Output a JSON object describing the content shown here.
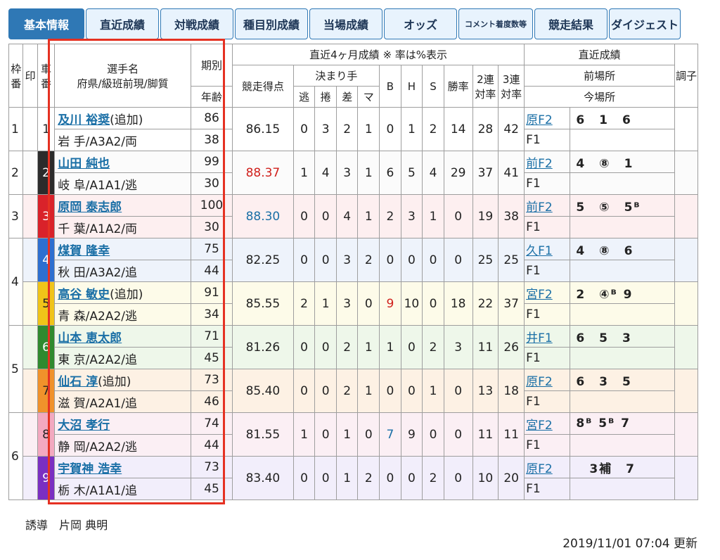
{
  "tabs": [
    {
      "label": "基本情報",
      "active": true
    },
    {
      "label": "直近成績"
    },
    {
      "label": "対戦成績"
    },
    {
      "label": "種目別成績"
    },
    {
      "label": "当場成績"
    },
    {
      "label": "オッズ"
    },
    {
      "label": "コメント着度数等",
      "small": true
    },
    {
      "label": "競走結果"
    },
    {
      "label": "ダイジェスト"
    }
  ],
  "headers": {
    "waku": "枠番",
    "mark": "印",
    "car": "車番",
    "name": "選手名",
    "pref": "府県/級班前現/脚質",
    "term": "期別",
    "age": "年齢",
    "recent4": "直近4ヶ月成績 ※ 率は%表示",
    "score": "競走得点",
    "kimarite": "決まり手",
    "nige": "逃",
    "makuri": "捲",
    "sashi": "差",
    "mark_k": "マ",
    "b": "B",
    "h": "H",
    "s": "S",
    "win": "勝率",
    "ren2": "2連対率",
    "ren3": "3連対率",
    "recent": "直近成績",
    "prev_place": "前場所",
    "cur_place": "今場所",
    "chou": "調子"
  },
  "waku_labels": [
    "1",
    "2",
    "3",
    "4",
    "5",
    "6"
  ],
  "riders": [
    {
      "car": "1",
      "carcolor": "#ffffff",
      "cartext": "#222",
      "name": "及川 裕奨",
      "suffix": "(追加)",
      "pref": "岩 手/A3A2/両",
      "term": "86",
      "age": "38",
      "score": "86.15",
      "score_color": "#222",
      "nige": "0",
      "makuri": "3",
      "sashi": "2",
      "mark": "1",
      "b": "0",
      "h": "1",
      "s": "2",
      "win": "14",
      "ren2": "28",
      "ren3": "42",
      "prev_place": "原F2",
      "prev_res": "6　1　6",
      "cur_place": "F1"
    },
    {
      "car": "2",
      "carcolor": "#2b2b2b",
      "cartext": "#fff",
      "name": "山田 純也",
      "suffix": "",
      "pref": "岐 阜/A1A1/逃",
      "term": "99",
      "age": "30",
      "score": "88.37",
      "score_color": "#d0201c",
      "nige": "1",
      "makuri": "4",
      "sashi": "3",
      "mark": "1",
      "b": "6",
      "h": "5",
      "s": "4",
      "win": "29",
      "ren2": "37",
      "ren3": "41",
      "prev_place": "前F2",
      "prev_res": "4　⑧　1",
      "cur_place": "F1"
    },
    {
      "car": "3",
      "carcolor": "#d9222a",
      "cartext": "#fff",
      "name": "原岡 泰志郎",
      "suffix": "",
      "pref": "千 葉/A1A2/両",
      "term": "100",
      "age": "30",
      "score": "88.30",
      "score_color": "#1a6fa6",
      "nige": "0",
      "makuri": "0",
      "sashi": "4",
      "mark": "1",
      "b": "2",
      "h": "3",
      "s": "1",
      "win": "0",
      "ren2": "19",
      "ren3": "38",
      "prev_place": "前F2",
      "prev_res": "5　⑤　5ᴮ",
      "cur_place": "F1"
    },
    {
      "car": "4",
      "carcolor": "#2d6fd0",
      "cartext": "#fff",
      "name": "煤賀 隆幸",
      "suffix": "",
      "pref": "秋 田/A3A2/追",
      "term": "75",
      "age": "44",
      "score": "82.25",
      "score_color": "#222",
      "nige": "0",
      "makuri": "0",
      "sashi": "3",
      "mark": "2",
      "b": "0",
      "h": "0",
      "s": "0",
      "win": "0",
      "ren2": "25",
      "ren3": "25",
      "prev_place": "久F1",
      "prev_res": "4　⑧　6",
      "cur_place": "F1"
    },
    {
      "car": "5",
      "carcolor": "#f0c419",
      "cartext": "#222",
      "name": "高谷 敏史",
      "suffix": "(追加)",
      "pref": "青 森/A2A2/逃",
      "term": "91",
      "age": "34",
      "score": "85.55",
      "score_color": "#222",
      "nige": "2",
      "makuri": "1",
      "sashi": "3",
      "mark": "0",
      "b": "9",
      "b_color": "#d0201c",
      "h": "10",
      "s": "0",
      "win": "18",
      "ren2": "22",
      "ren3": "37",
      "prev_place": "宮F2",
      "prev_res": "2　④ᴮ 9",
      "cur_place": "F1"
    },
    {
      "car": "6",
      "carcolor": "#2f8a2f",
      "cartext": "#fff",
      "name": "山本 恵太郎",
      "suffix": "",
      "pref": "東 京/A2A2/追",
      "term": "71",
      "age": "45",
      "score": "81.26",
      "score_color": "#222",
      "nige": "0",
      "makuri": "0",
      "sashi": "2",
      "mark": "1",
      "b": "1",
      "h": "0",
      "s": "2",
      "win": "3",
      "ren2": "11",
      "ren3": "26",
      "prev_place": "井F1",
      "prev_res": "6　5　3",
      "cur_place": "F1"
    },
    {
      "car": "7",
      "carcolor": "#f0922b",
      "cartext": "#222",
      "name": "仙石 淳",
      "suffix": "(追加)",
      "pref": "滋 賀/A2A1/追",
      "term": "73",
      "age": "46",
      "score": "85.40",
      "score_color": "#222",
      "nige": "0",
      "makuri": "0",
      "sashi": "2",
      "mark": "1",
      "b": "0",
      "h": "0",
      "s": "1",
      "win": "0",
      "ren2": "13",
      "ren3": "18",
      "prev_place": "原F2",
      "prev_res": "6　3　5",
      "cur_place": "F1"
    },
    {
      "car": "8",
      "carcolor": "#f3a9c0",
      "cartext": "#222",
      "name": "大沼 孝行",
      "suffix": "",
      "pref": "静 岡/A2A2/逃",
      "term": "74",
      "age": "44",
      "score": "81.55",
      "score_color": "#222",
      "nige": "1",
      "makuri": "0",
      "sashi": "1",
      "mark": "0",
      "b": "7",
      "b_color": "#1a6fa6",
      "h": "9",
      "s": "0",
      "win": "0",
      "ren2": "11",
      "ren3": "11",
      "prev_place": "宮F2",
      "prev_res": "8ᴮ 5ᴮ 7",
      "cur_place": "F1"
    },
    {
      "car": "9",
      "carcolor": "#7a2fc2",
      "cartext": "#fff",
      "name": "宇賀神 浩幸",
      "suffix": "",
      "pref": "栃 木/A1A1/追",
      "term": "73",
      "age": "45",
      "score": "83.40",
      "score_color": "#222",
      "nige": "0",
      "makuri": "0",
      "sashi": "1",
      "mark": "2",
      "b": "0",
      "h": "0",
      "s": "2",
      "win": "0",
      "ren2": "10",
      "ren3": "20",
      "prev_place": "原F2",
      "prev_res": "　3補　7",
      "cur_place": "F1"
    }
  ],
  "waku_spans": [
    {
      "label": "1",
      "rows": 1
    },
    {
      "label": "2",
      "rows": 1
    },
    {
      "label": "3",
      "rows": 1
    },
    {
      "label": "4",
      "rows": 2
    },
    {
      "label": "5",
      "rows": 2
    },
    {
      "label": "6",
      "rows": 2
    }
  ],
  "footer": {
    "guide": "誘導　片岡 典明",
    "updated": "2019/11/01 07:04 更新"
  }
}
